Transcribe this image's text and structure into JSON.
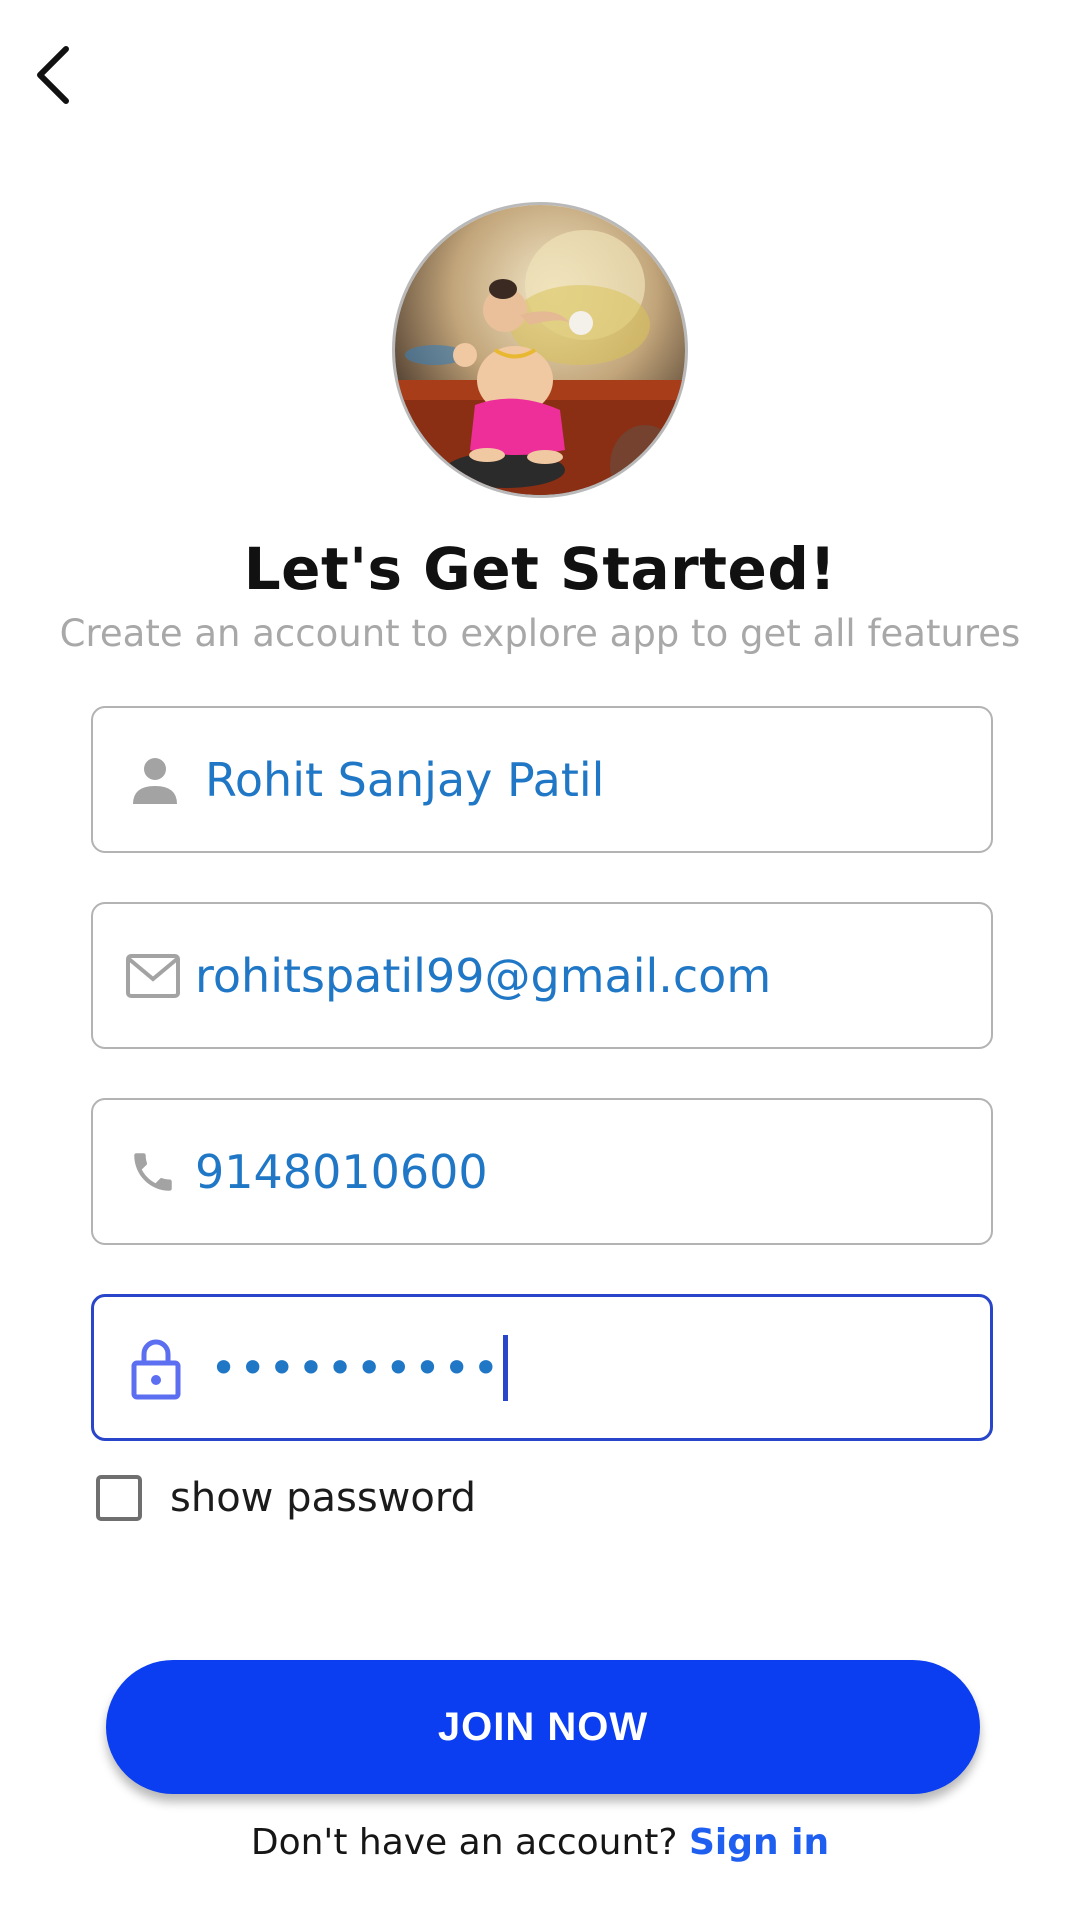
{
  "header": {
    "back_icon": "chevron-left-icon"
  },
  "profile": {
    "avatar_icon": "profile-photo"
  },
  "title": "Let's Get Started!",
  "subtitle": "Create an account to explore app to get all features",
  "form": {
    "name": {
      "icon": "person-icon",
      "value": "Rohit Sanjay Patil"
    },
    "email": {
      "icon": "mail-icon",
      "value": "rohitspatil99@gmail.com"
    },
    "phone": {
      "icon": "phone-icon",
      "value": "9148010600"
    },
    "password": {
      "icon": "lock-icon",
      "masked_value": "••••••••••"
    },
    "show_password_label": "show password",
    "show_password_checked": false
  },
  "join_button_label": "JOIN NOW",
  "footer": {
    "prompt": "Don't have an account?",
    "link_label": "Sign in"
  },
  "colors": {
    "accent": "#0a3ef0",
    "input_text": "#1f77c6",
    "focus_border": "#2945c9",
    "link": "#1f5ff0"
  }
}
